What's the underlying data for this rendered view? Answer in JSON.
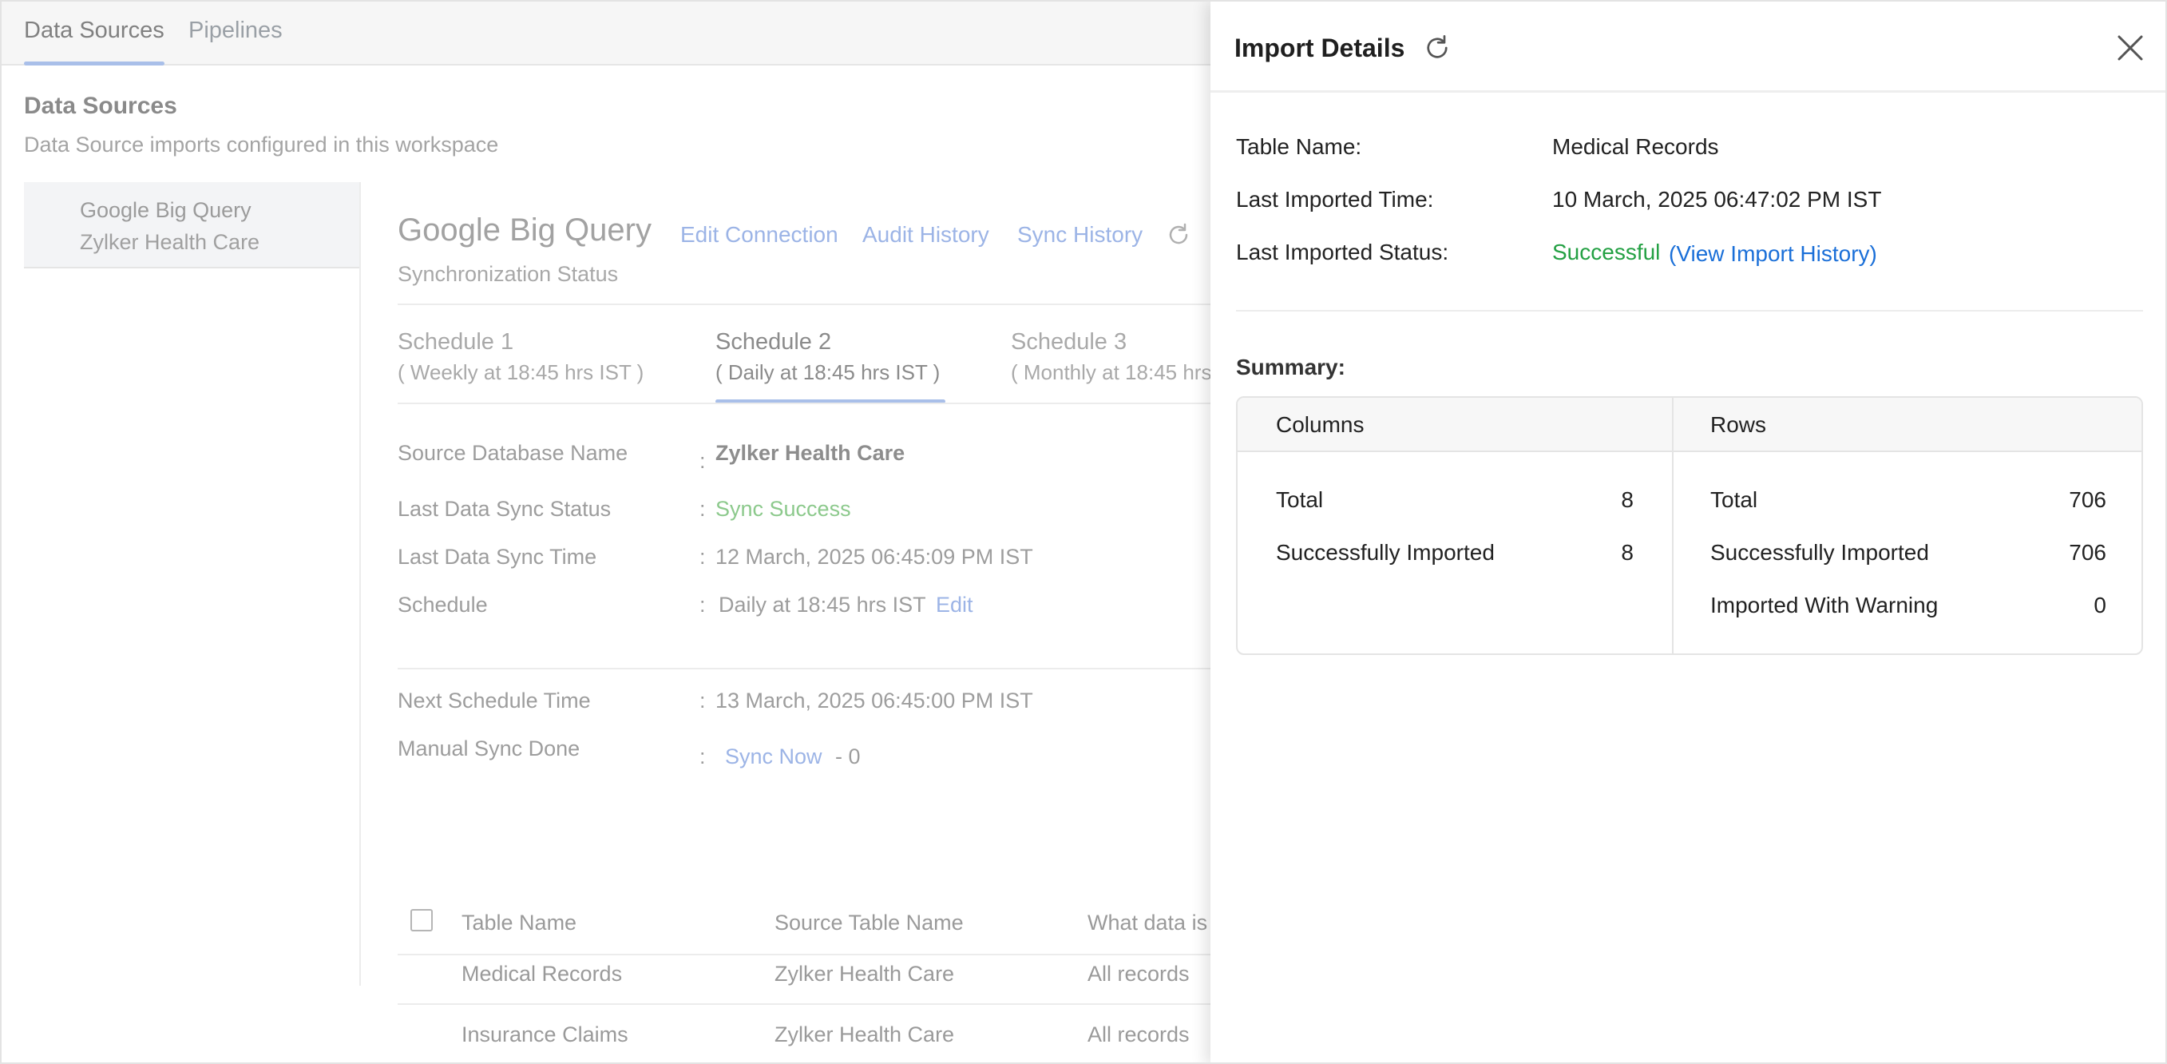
{
  "top_tabs": [
    {
      "label": "Data Sources",
      "active": true
    },
    {
      "label": "Pipelines",
      "active": false
    }
  ],
  "page": {
    "title": "Data Sources",
    "subtitle": "Data Source imports configured in this workspace"
  },
  "sidebar": {
    "items": [
      {
        "line1": "Google Big Query",
        "line2": "Zylker Health Care"
      }
    ]
  },
  "datasource": {
    "title": "Google Big Query",
    "links": {
      "edit_connection": "Edit Connection",
      "audit_history": "Audit History",
      "sync_history": "Sync History"
    },
    "subtitle": "Synchronization Status",
    "schedules": [
      {
        "name": "Schedule 1",
        "detail": "( Weekly at 18:45 hrs IST )",
        "active": false
      },
      {
        "name": "Schedule 2",
        "detail": "( Daily at 18:45 hrs IST )",
        "active": true
      },
      {
        "name": "Schedule 3",
        "detail": "( Monthly at 18:45 hrs",
        "active": false
      }
    ],
    "fields": {
      "source_db_label": "Source Database Name",
      "source_db_value": "Zylker Health Care",
      "last_status_label": "Last Data Sync Status",
      "last_status_value": "Sync Success",
      "last_time_label": "Last Data Sync Time",
      "last_time_value": "12 March, 2025 06:45:09 PM IST",
      "schedule_label": "Schedule",
      "schedule_value": "Daily at 18:45 hrs IST",
      "schedule_edit": "Edit",
      "next_label": "Next Schedule Time",
      "next_value": "13 March, 2025 06:45:00 PM IST",
      "manual_label": "Manual Sync Done",
      "sync_now": "Sync Now",
      "manual_count": "- 0",
      "colon": ":"
    },
    "table": {
      "headers": [
        "Table Name",
        "Source Table Name",
        "What data is"
      ],
      "rows": [
        [
          "Medical Records",
          "Zylker Health Care",
          "All records"
        ],
        [
          "Insurance Claims",
          "Zylker Health Care",
          "All records"
        ]
      ]
    }
  },
  "import_panel": {
    "title": "Import Details",
    "table_name_label": "Table Name:",
    "table_name_value": "Medical Records",
    "last_time_label": "Last Imported Time:",
    "last_time_value": "10 March, 2025 06:47:02 PM IST",
    "last_status_label": "Last Imported Status:",
    "last_status_value": "Successful",
    "view_history": "(View Import History)",
    "summary_label": "Summary:",
    "columns": {
      "header": "Columns",
      "rows": [
        {
          "label": "Total",
          "value": "8"
        },
        {
          "label": "Successfully Imported",
          "value": "8"
        }
      ]
    },
    "rows": {
      "header": "Rows",
      "rows": [
        {
          "label": "Total",
          "value": "706"
        },
        {
          "label": "Successfully Imported",
          "value": "706"
        },
        {
          "label": "Imported With Warning",
          "value": "0"
        }
      ]
    }
  }
}
